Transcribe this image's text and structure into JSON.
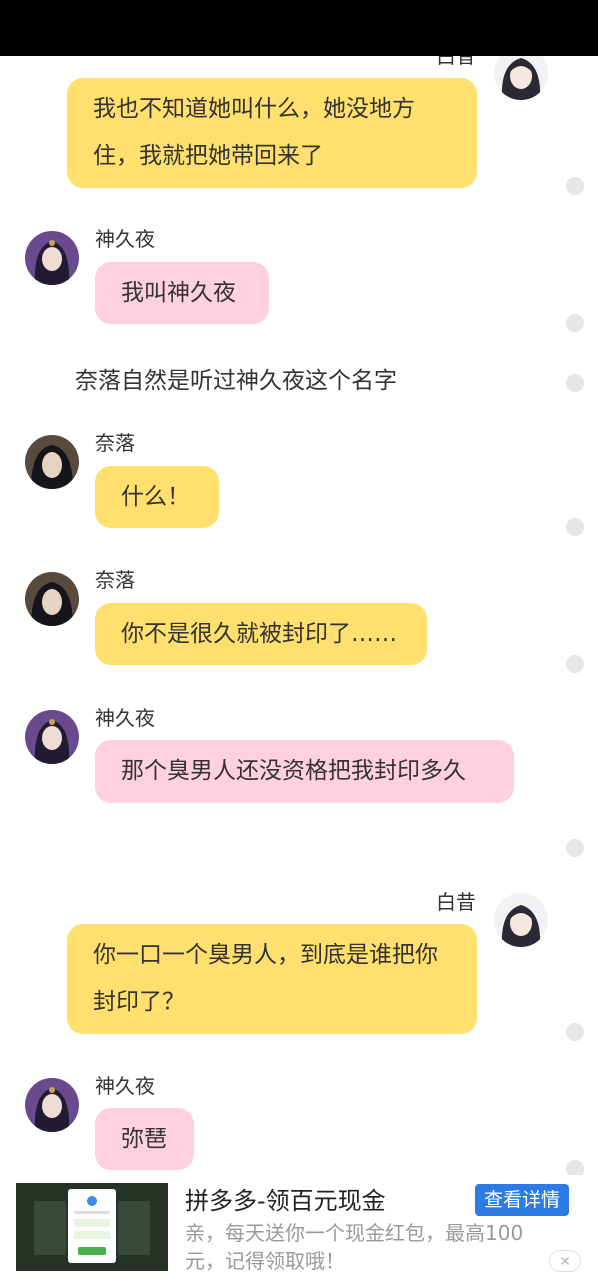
{
  "messages": [
    {
      "speaker": "白昔",
      "text": "我也不知道她叫什么，她没地方住，我就把她带回来了"
    },
    {
      "speaker": "神久夜",
      "text": "我叫神久夜"
    },
    {
      "narration": "奈落自然是听过神久夜这个名字"
    },
    {
      "speaker": "奈落",
      "text": "什么！"
    },
    {
      "speaker": "奈落",
      "text": "你不是很久就被封印了……"
    },
    {
      "speaker": "神久夜",
      "text": "那个臭男人还没资格把我封印多久"
    },
    {
      "speaker": "白昔",
      "text": "你一口一个臭男人，到底是谁把你封印了？"
    },
    {
      "speaker": "神久夜",
      "text": "弥琶"
    }
  ],
  "ad": {
    "title": "拼多多-领百元现金",
    "button": "查看详情",
    "description": "亲，每天送你一个现金红包，最高100元，记得领取哦！",
    "close": "✕"
  },
  "colors": {
    "self_bubble": "#ffdf6e",
    "other_bubble": "#ffd1df",
    "ad_button": "#2e7be6"
  }
}
